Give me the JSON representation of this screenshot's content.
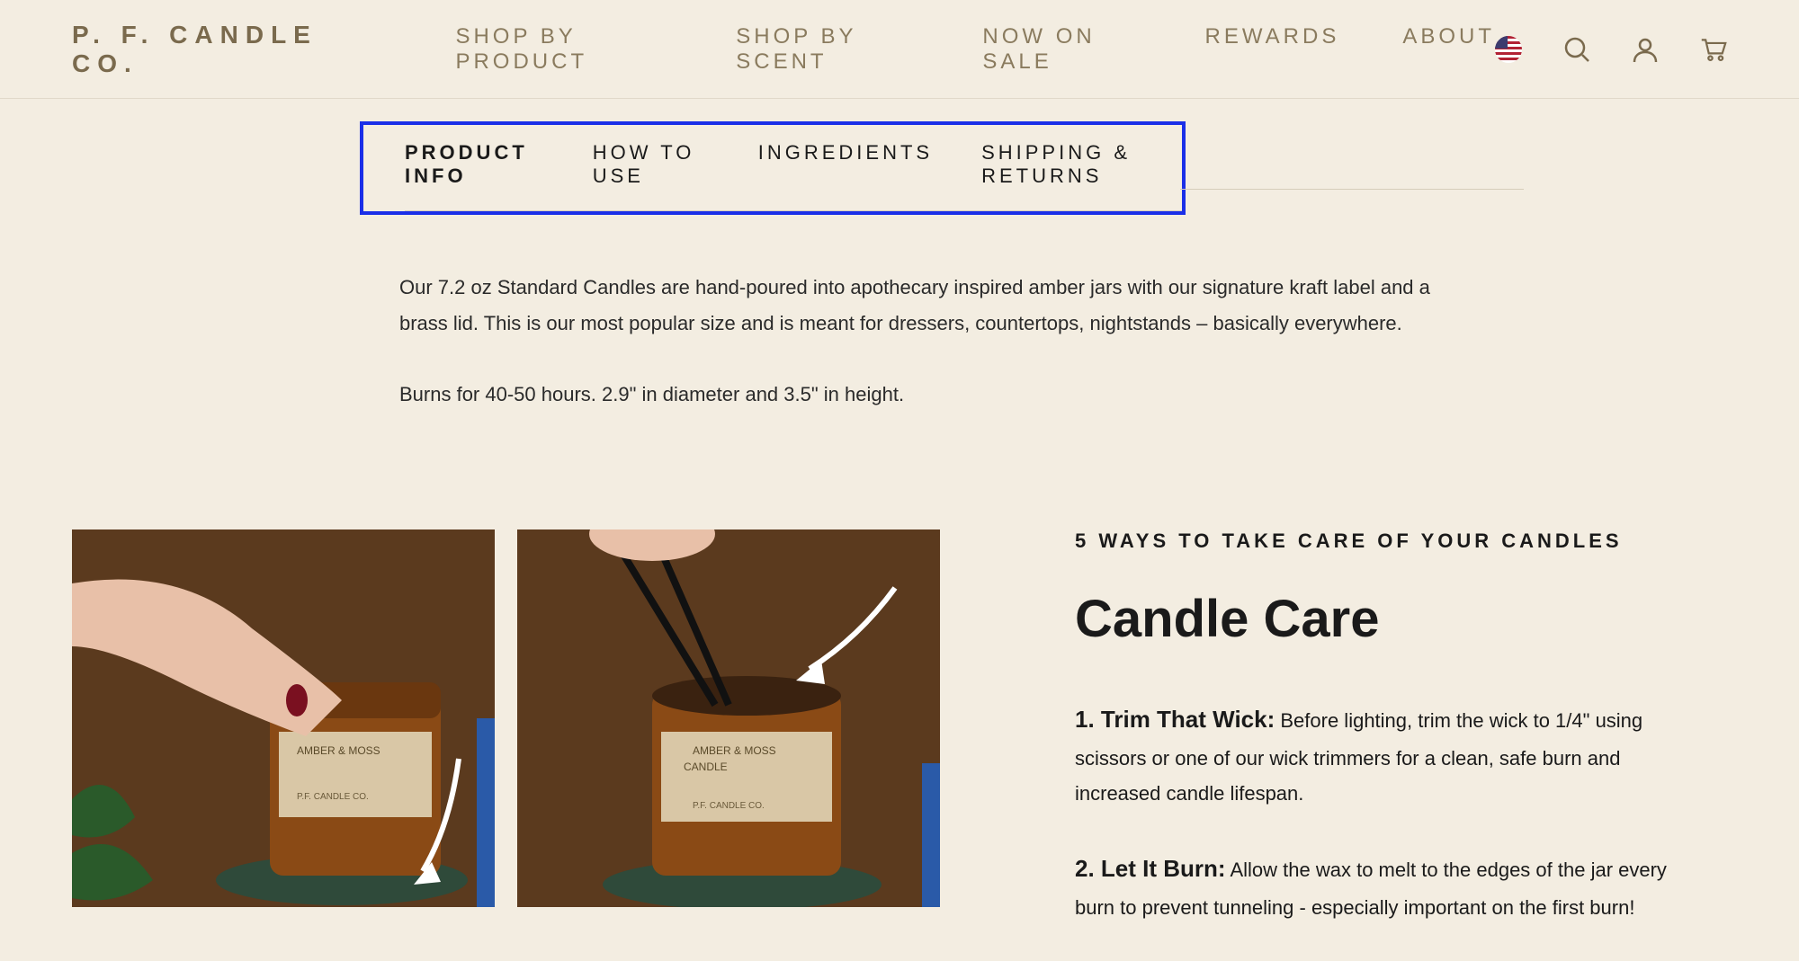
{
  "header": {
    "logo": "P. F. CANDLE CO.",
    "nav": [
      "SHOP BY PRODUCT",
      "SHOP BY SCENT",
      "NOW ON SALE",
      "REWARDS",
      "ABOUT"
    ]
  },
  "tabs": {
    "items": [
      "PRODUCT INFO",
      "HOW TO USE",
      "INGREDIENTS",
      "SHIPPING & RETURNS"
    ],
    "active": 0
  },
  "product": {
    "p1": "Our 7.2 oz Standard Candles are hand-poured into apothecary inspired amber jars with our signature kraft label and a brass lid. This is our most popular size and is meant for dressers, countertops, nightstands – basically everywhere.",
    "p2": "Burns for 40-50 hours. 2.9\" in diameter and 3.5\" in height."
  },
  "care": {
    "eyebrow": "5 WAYS TO TAKE CARE OF YOUR CANDLES",
    "title": "Candle Care",
    "items": [
      {
        "head": "1. Trim That Wick:",
        "body": " Before lighting, trim the wick to 1/4\" using scissors or one of our wick trimmers for a clean, safe burn and increased candle lifespan."
      },
      {
        "head": "2. Let It Burn:",
        "body": " Allow the wax to melt to the edges of the jar every burn to prevent tunneling - especially important on the first burn!"
      }
    ]
  }
}
